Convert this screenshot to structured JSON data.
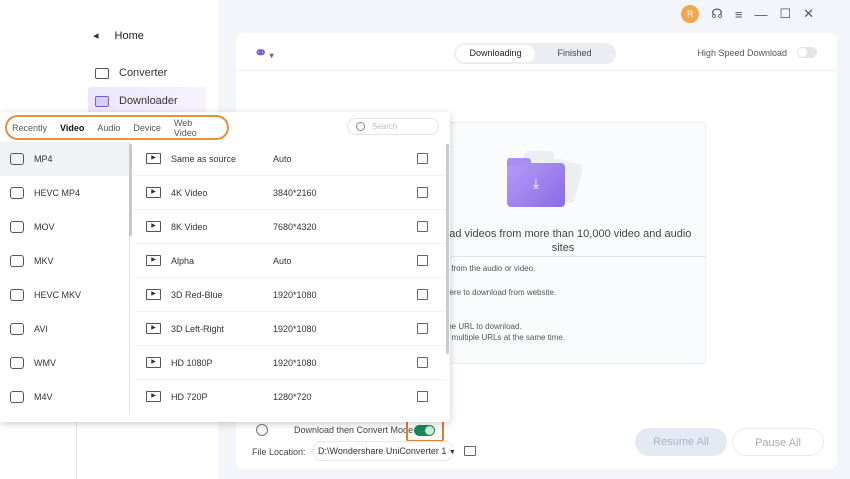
{
  "sidebar": {
    "home": "Home",
    "items": [
      {
        "label": "Converter",
        "icon": "converter-icon"
      },
      {
        "label": "Downloader",
        "icon": "downloader-icon"
      }
    ]
  },
  "titlebar": {
    "avatar": "R",
    "icons": [
      "headset-icon",
      "menu-icon",
      "minimize-icon",
      "maximize-icon",
      "close-icon"
    ]
  },
  "toolbar": {
    "tabs": [
      "Downloading",
      "Finished"
    ],
    "high_speed_label": "High Speed Download",
    "high_speed_on": false
  },
  "dropzone": {
    "title": "nload videos from more than 10,000 video and audio sites",
    "lines": [
      "k from the audio or video.",
      "here to download from website.",
      "the URL to download.",
      "d multiple URLs at the same time."
    ]
  },
  "bottom": {
    "mode_label": "Download then Convert Mode",
    "mode_on": true,
    "file_location_label": "File Location:",
    "file_location_value": "D:\\Wondershare UniConverter 1",
    "resume": "Resume All",
    "pause": "Pause All"
  },
  "popup": {
    "tabs": [
      "Recently",
      "Video",
      "Audio",
      "Device",
      "Web Video"
    ],
    "selected_tab": "Video",
    "search_placeholder": "Search",
    "formats": [
      "MP4",
      "HEVC MP4",
      "MOV",
      "MKV",
      "HEVC MKV",
      "AVI",
      "WMV",
      "M4V"
    ],
    "presets": [
      {
        "name": "Same as source",
        "res": "Auto"
      },
      {
        "name": "4K Video",
        "res": "3840*2160"
      },
      {
        "name": "8K Video",
        "res": "7680*4320"
      },
      {
        "name": "Alpha",
        "res": "Auto"
      },
      {
        "name": "3D Red-Blue",
        "res": "1920*1080"
      },
      {
        "name": "3D Left-Right",
        "res": "1920*1080"
      },
      {
        "name": "HD 1080P",
        "res": "1920*1080"
      },
      {
        "name": "HD 720P",
        "res": "1280*720"
      }
    ]
  },
  "colors": {
    "accent": "#7a5ad6",
    "highlight": "#e0923f",
    "toggle_on": "#17884f"
  }
}
